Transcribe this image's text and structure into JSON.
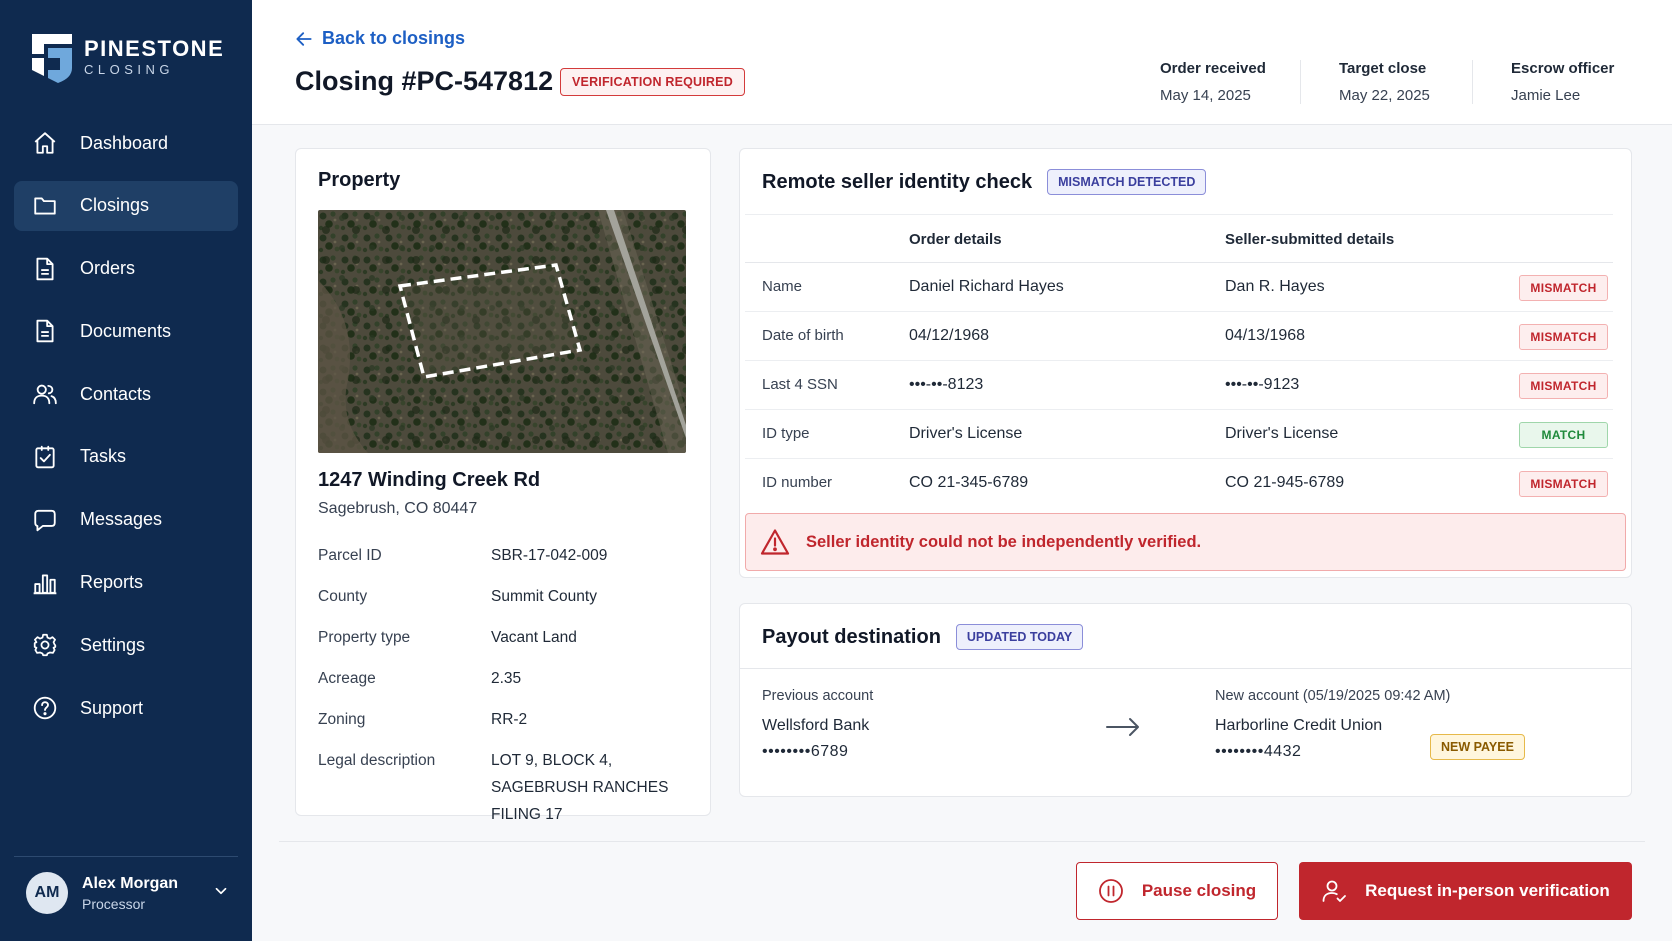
{
  "brand": {
    "name": "PINESTONE",
    "sub": "CLOSING"
  },
  "sidebar": {
    "items": [
      {
        "label": "Dashboard",
        "icon": "home-icon"
      },
      {
        "label": "Closings",
        "icon": "folder-icon",
        "active": true
      },
      {
        "label": "Orders",
        "icon": "document-icon"
      },
      {
        "label": "Documents",
        "icon": "document-icon"
      },
      {
        "label": "Contacts",
        "icon": "users-icon"
      },
      {
        "label": "Tasks",
        "icon": "checklist-icon"
      },
      {
        "label": "Messages",
        "icon": "message-icon"
      },
      {
        "label": "Reports",
        "icon": "bar-chart-icon"
      },
      {
        "label": "Settings",
        "icon": "gear-icon"
      },
      {
        "label": "Support",
        "icon": "help-icon"
      }
    ],
    "user": {
      "initials": "AM",
      "name": "Alex Morgan",
      "role": "Processor"
    }
  },
  "header": {
    "back": "Back to closings",
    "title": "Closing #PC-547812",
    "status_badge": "VERIFICATION REQUIRED",
    "meta": [
      {
        "label": "Order received",
        "value": "May 14, 2025"
      },
      {
        "label": "Target close",
        "value": "May 22, 2025"
      },
      {
        "label": "Escrow officer",
        "value": "Jamie Lee"
      }
    ]
  },
  "property": {
    "title": "Property",
    "address_line1": "1247 Winding Creek Rd",
    "address_line2": "Sagebrush, CO 80447",
    "fields": [
      {
        "k": "Parcel ID",
        "v": "SBR-17-042-009"
      },
      {
        "k": "County",
        "v": "Summit County"
      },
      {
        "k": "Property type",
        "v": "Vacant Land"
      },
      {
        "k": "Acreage",
        "v": "2.35"
      },
      {
        "k": "Zoning",
        "v": "RR-2"
      },
      {
        "k": "Legal description",
        "v": "LOT 9, BLOCK 4, SAGEBRUSH RANCHES FILING 17"
      }
    ]
  },
  "identity": {
    "title": "Remote seller identity check",
    "badge": "MISMATCH DETECTED",
    "col_order": "Order details",
    "col_seller": "Seller-submitted details",
    "rows": [
      {
        "field": "Name",
        "order": "Daniel Richard Hayes",
        "seller": "Dan R. Hayes",
        "status": "MISMATCH"
      },
      {
        "field": "Date of birth",
        "order": "04/12/1968",
        "seller": "04/13/1968",
        "status": "MISMATCH"
      },
      {
        "field": "Last 4 SSN",
        "order": "•••-••-8123",
        "seller": "•••-••-9123",
        "status": "MISMATCH"
      },
      {
        "field": "ID type",
        "order": "Driver's License",
        "seller": "Driver's License",
        "status": "MATCH"
      },
      {
        "field": "ID number",
        "order": "CO 21-345-6789",
        "seller": "CO 21-945-6789",
        "status": "MISMATCH"
      }
    ],
    "alert": "Seller identity could not be independently verified."
  },
  "payout": {
    "title": "Payout destination",
    "badge": "UPDATED TODAY",
    "previous_label": "Previous account",
    "previous_bank": "Wellsford Bank",
    "previous_acct": "••••••••6789",
    "new_label": "New account (05/19/2025 09:42 AM)",
    "new_bank": "Harborline Credit Union",
    "new_acct": "••••••••4432",
    "new_badge": "NEW PAYEE"
  },
  "actions": {
    "pause": "Pause closing",
    "request": "Request in-person verification"
  }
}
